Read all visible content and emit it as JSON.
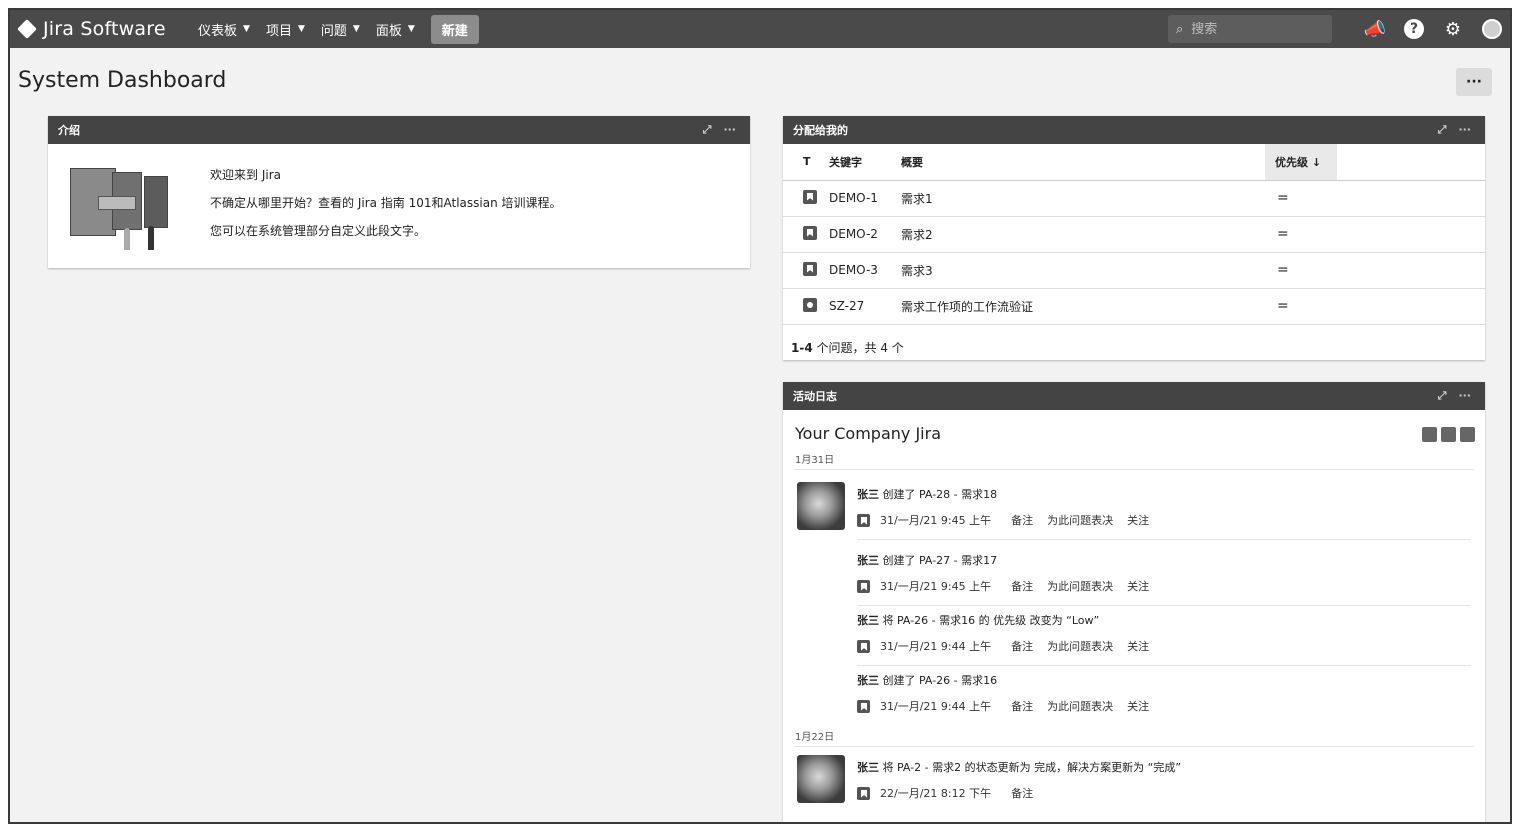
{
  "nav": {
    "logo": "Jira Software",
    "menus": [
      "仪表板",
      "项目",
      "问题",
      "面板"
    ],
    "create": "新建",
    "search_placeholder": "搜索",
    "icons": [
      "notifications-icon",
      "help-icon",
      "settings-icon",
      "profile-icon"
    ]
  },
  "page": {
    "title": "System Dashboard",
    "more": "···"
  },
  "intro": {
    "title": "介绍",
    "line1": "欢迎来到 Jira",
    "line2": "不确定从哪里开始？查看的 Jira 指南 101和Atlassian 培训课程。",
    "line3": "您可以在系统管理部分自定义此段文字。"
  },
  "assigned": {
    "title": "分配给我的",
    "headers": {
      "type": "T",
      "key": "关键字",
      "summary": "概要",
      "priority": "优先级 ↓"
    },
    "rows": [
      {
        "type": "bookmark",
        "key": "DEMO-1",
        "summary": "需求1",
        "priority": "="
      },
      {
        "type": "bookmark",
        "key": "DEMO-2",
        "summary": "需求2",
        "priority": "="
      },
      {
        "type": "bookmark",
        "key": "DEMO-3",
        "summary": "需求3",
        "priority": "="
      },
      {
        "type": "task",
        "key": "SZ-27",
        "summary": "需求工作项的工作流验证",
        "priority": "="
      }
    ],
    "footer_range": "1-4",
    "footer_text": " 个问题，共 4 个"
  },
  "activity": {
    "title": "活动日志",
    "stream_title": "Your Company Jira",
    "date1": "1月31日",
    "date2": "1月22日",
    "entries": [
      {
        "user": "张三",
        "text": " 创建了 PA-28 - 需求18",
        "time": "31/一月/21 9:45 上午",
        "actions": [
          "备注",
          "为此问题表决",
          "关注"
        ]
      },
      {
        "user": "张三",
        "text": " 创建了 PA-27 - 需求17",
        "time": "31/一月/21 9:45 上午",
        "actions": [
          "备注",
          "为此问题表决",
          "关注"
        ]
      },
      {
        "user": "张三",
        "text": " 将 PA-26 - 需求16 的 优先级 改变为 “Low”",
        "time": "31/一月/21 9:44 上午",
        "actions": [
          "备注",
          "为此问题表决",
          "关注"
        ]
      },
      {
        "user": "张三",
        "text": " 创建了 PA-26 - 需求16",
        "time": "31/一月/21 9:44 上午",
        "actions": [
          "备注",
          "为此问题表决",
          "关注"
        ]
      },
      {
        "user": "张三",
        "text": " 将 PA-2 - 需求2 的状态更新为 完成，解决方案更新为 “完成”",
        "time": "22/一月/21 8:12 下午",
        "actions": [
          "备注"
        ]
      }
    ]
  }
}
